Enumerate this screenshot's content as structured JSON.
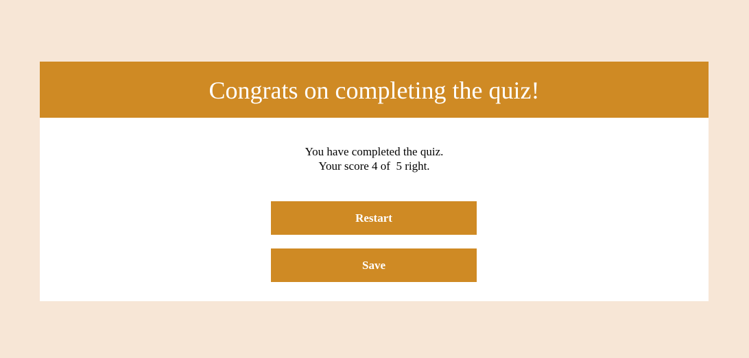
{
  "header": {
    "title": "Congrats on completing the quiz!"
  },
  "result": {
    "line1": "You have completed the quiz.",
    "line2": "Your score 4 of  5 right.",
    "score": 4,
    "total": 5
  },
  "actions": {
    "restart_label": "Restart",
    "save_label": "Save"
  },
  "colors": {
    "background": "#f7e6d6",
    "accent": "#cf8a24",
    "card": "#ffffff"
  }
}
